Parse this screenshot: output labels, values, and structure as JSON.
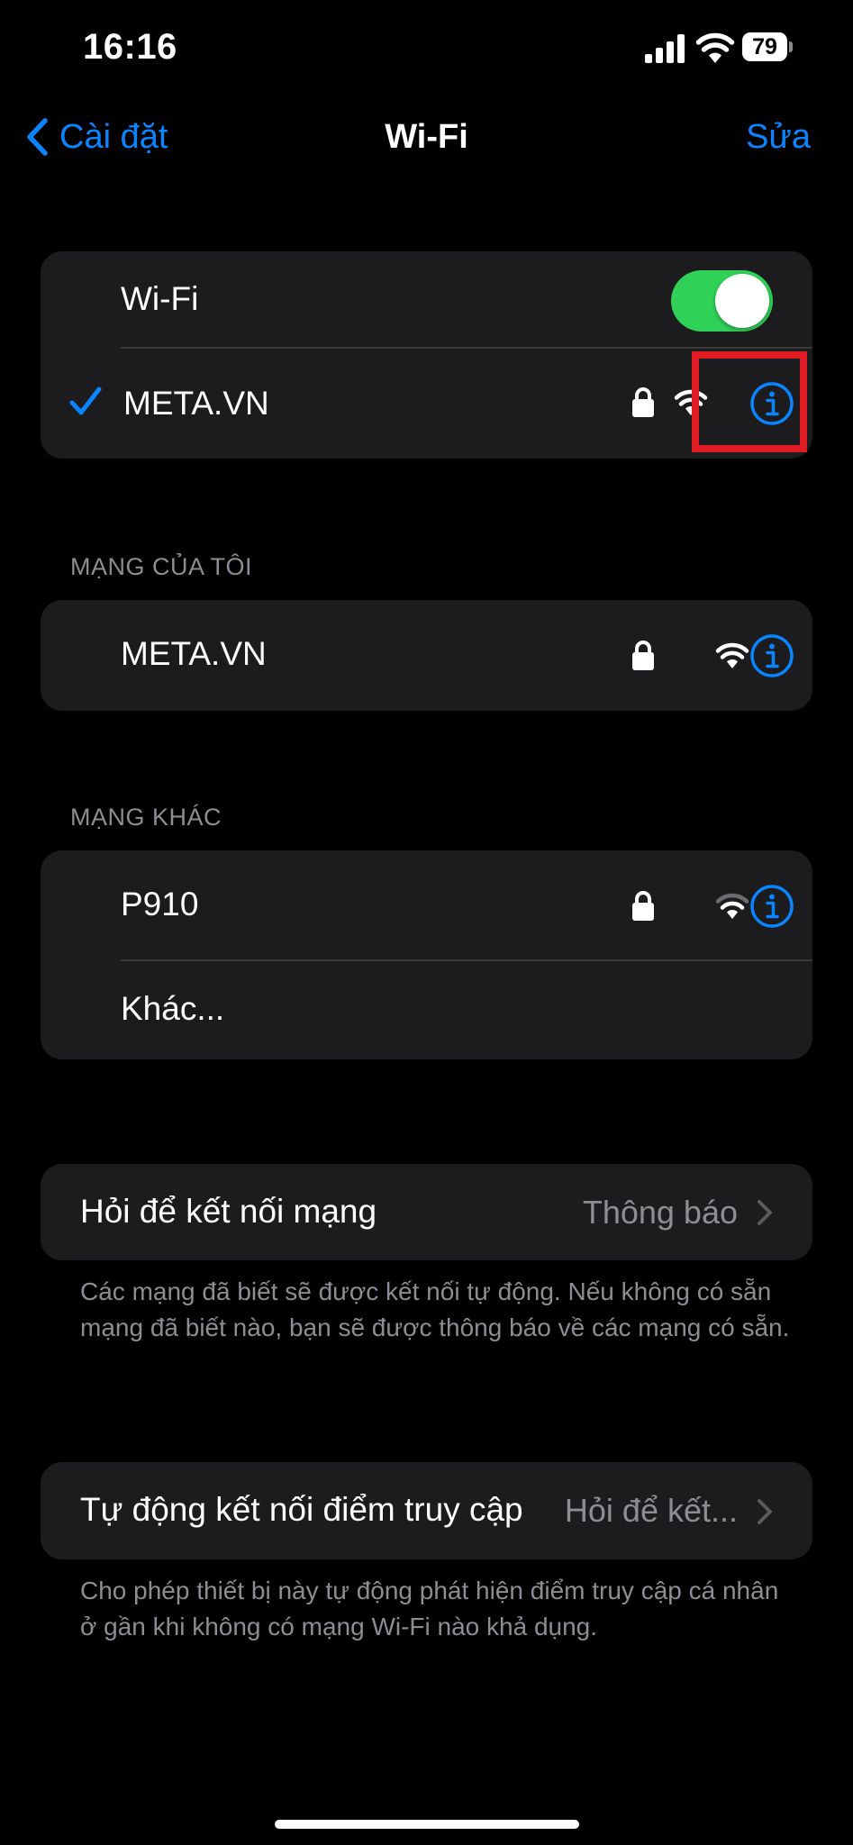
{
  "status_bar": {
    "time": "16:16",
    "battery_level": "79"
  },
  "nav": {
    "back_label": "Cài đặt",
    "title": "Wi-Fi",
    "edit_label": "Sửa"
  },
  "wifi_group": {
    "toggle_label": "Wi-Fi",
    "toggle_on": true,
    "connected_network": "META.VN"
  },
  "my_networks": {
    "header": "MẠNG CỦA TÔI",
    "items": [
      {
        "name": "META.VN"
      }
    ]
  },
  "other_networks": {
    "header": "MẠNG KHÁC",
    "items": [
      {
        "name": "P910"
      }
    ],
    "other_label": "Khác..."
  },
  "ask_to_join": {
    "label": "Hỏi để kết nối mạng",
    "value": "Thông báo",
    "footnote": "Các mạng đã biết sẽ được kết nối tự động. Nếu không có sẵn mạng đã biết nào, bạn sẽ được thông báo về các mạng có sẵn."
  },
  "auto_join_hotspot": {
    "label": "Tự động kết nối điểm truy cập",
    "value": "Hỏi để kết...",
    "footnote": "Cho phép thiết bị này tự động phát hiện điểm truy cập cá nhân ở gần khi không có mạng Wi-Fi nào khả dụng."
  },
  "colors": {
    "accent": "#0a84ff",
    "toggle_on": "#30d158",
    "highlight": "#e01b24",
    "group_background": "#1c1c1e",
    "secondary_text": "#8d8d93"
  }
}
